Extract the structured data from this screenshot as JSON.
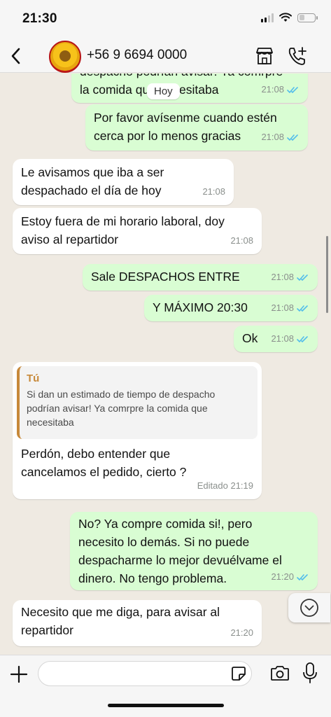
{
  "status_bar": {
    "time": "21:30"
  },
  "header": {
    "contact_name": "+56 9 6694 0000"
  },
  "chat": {
    "day_label": "Hoy",
    "messages": [
      {
        "direction": "out",
        "text": "despacho podrían avisar! Ya comrpre\nla comida que necesitaba",
        "time": "21:08",
        "status": "read"
      },
      {
        "direction": "out",
        "text": "Por favor avísenme cuando estén\ncerca por lo menos gracias",
        "time": "21:08",
        "status": "read"
      },
      {
        "direction": "in",
        "text": "Le avisamos que iba a ser\ndespachado el día de hoy",
        "time": "21:08"
      },
      {
        "direction": "in",
        "text": "Estoy fuera de mi horario laboral, doy\naviso al repartidor",
        "time": "21:08"
      },
      {
        "direction": "out",
        "text": "Sale DESPACHOS ENTRE",
        "time": "21:08",
        "status": "read"
      },
      {
        "direction": "out",
        "text": "Y MÁXIMO 20:30",
        "time": "21:08",
        "status": "read"
      },
      {
        "direction": "out",
        "text": "Ok",
        "time": "21:08",
        "status": "read"
      },
      {
        "direction": "in",
        "quote": {
          "author": "Tú",
          "text": "Si dan un estimado de tiempo de despacho\npodrían avisar! Ya comrpre la comida que\nnecesitaba"
        },
        "text": "Perdón, debo entender que\ncancelamos el pedido, cierto ?",
        "time": "Editado 21:19"
      },
      {
        "direction": "out",
        "text": "No? Ya compre comida si!, pero\nnecesito lo demás. Si no puede\ndespacharme lo mejor devuélvame el\ndinero. No tengo problema.",
        "time": "21:20",
        "status": "read"
      },
      {
        "direction": "in",
        "text": "Necesito que me diga, para avisar al\nrepartidor",
        "time": "21:20"
      }
    ]
  },
  "composer": {
    "value": "",
    "placeholder": ""
  },
  "colors": {
    "outgoing_bubble": "#d9fdd3",
    "incoming_bubble": "#ffffff",
    "read_ticks": "#53bdeb",
    "quote_accent": "#c7893a"
  }
}
